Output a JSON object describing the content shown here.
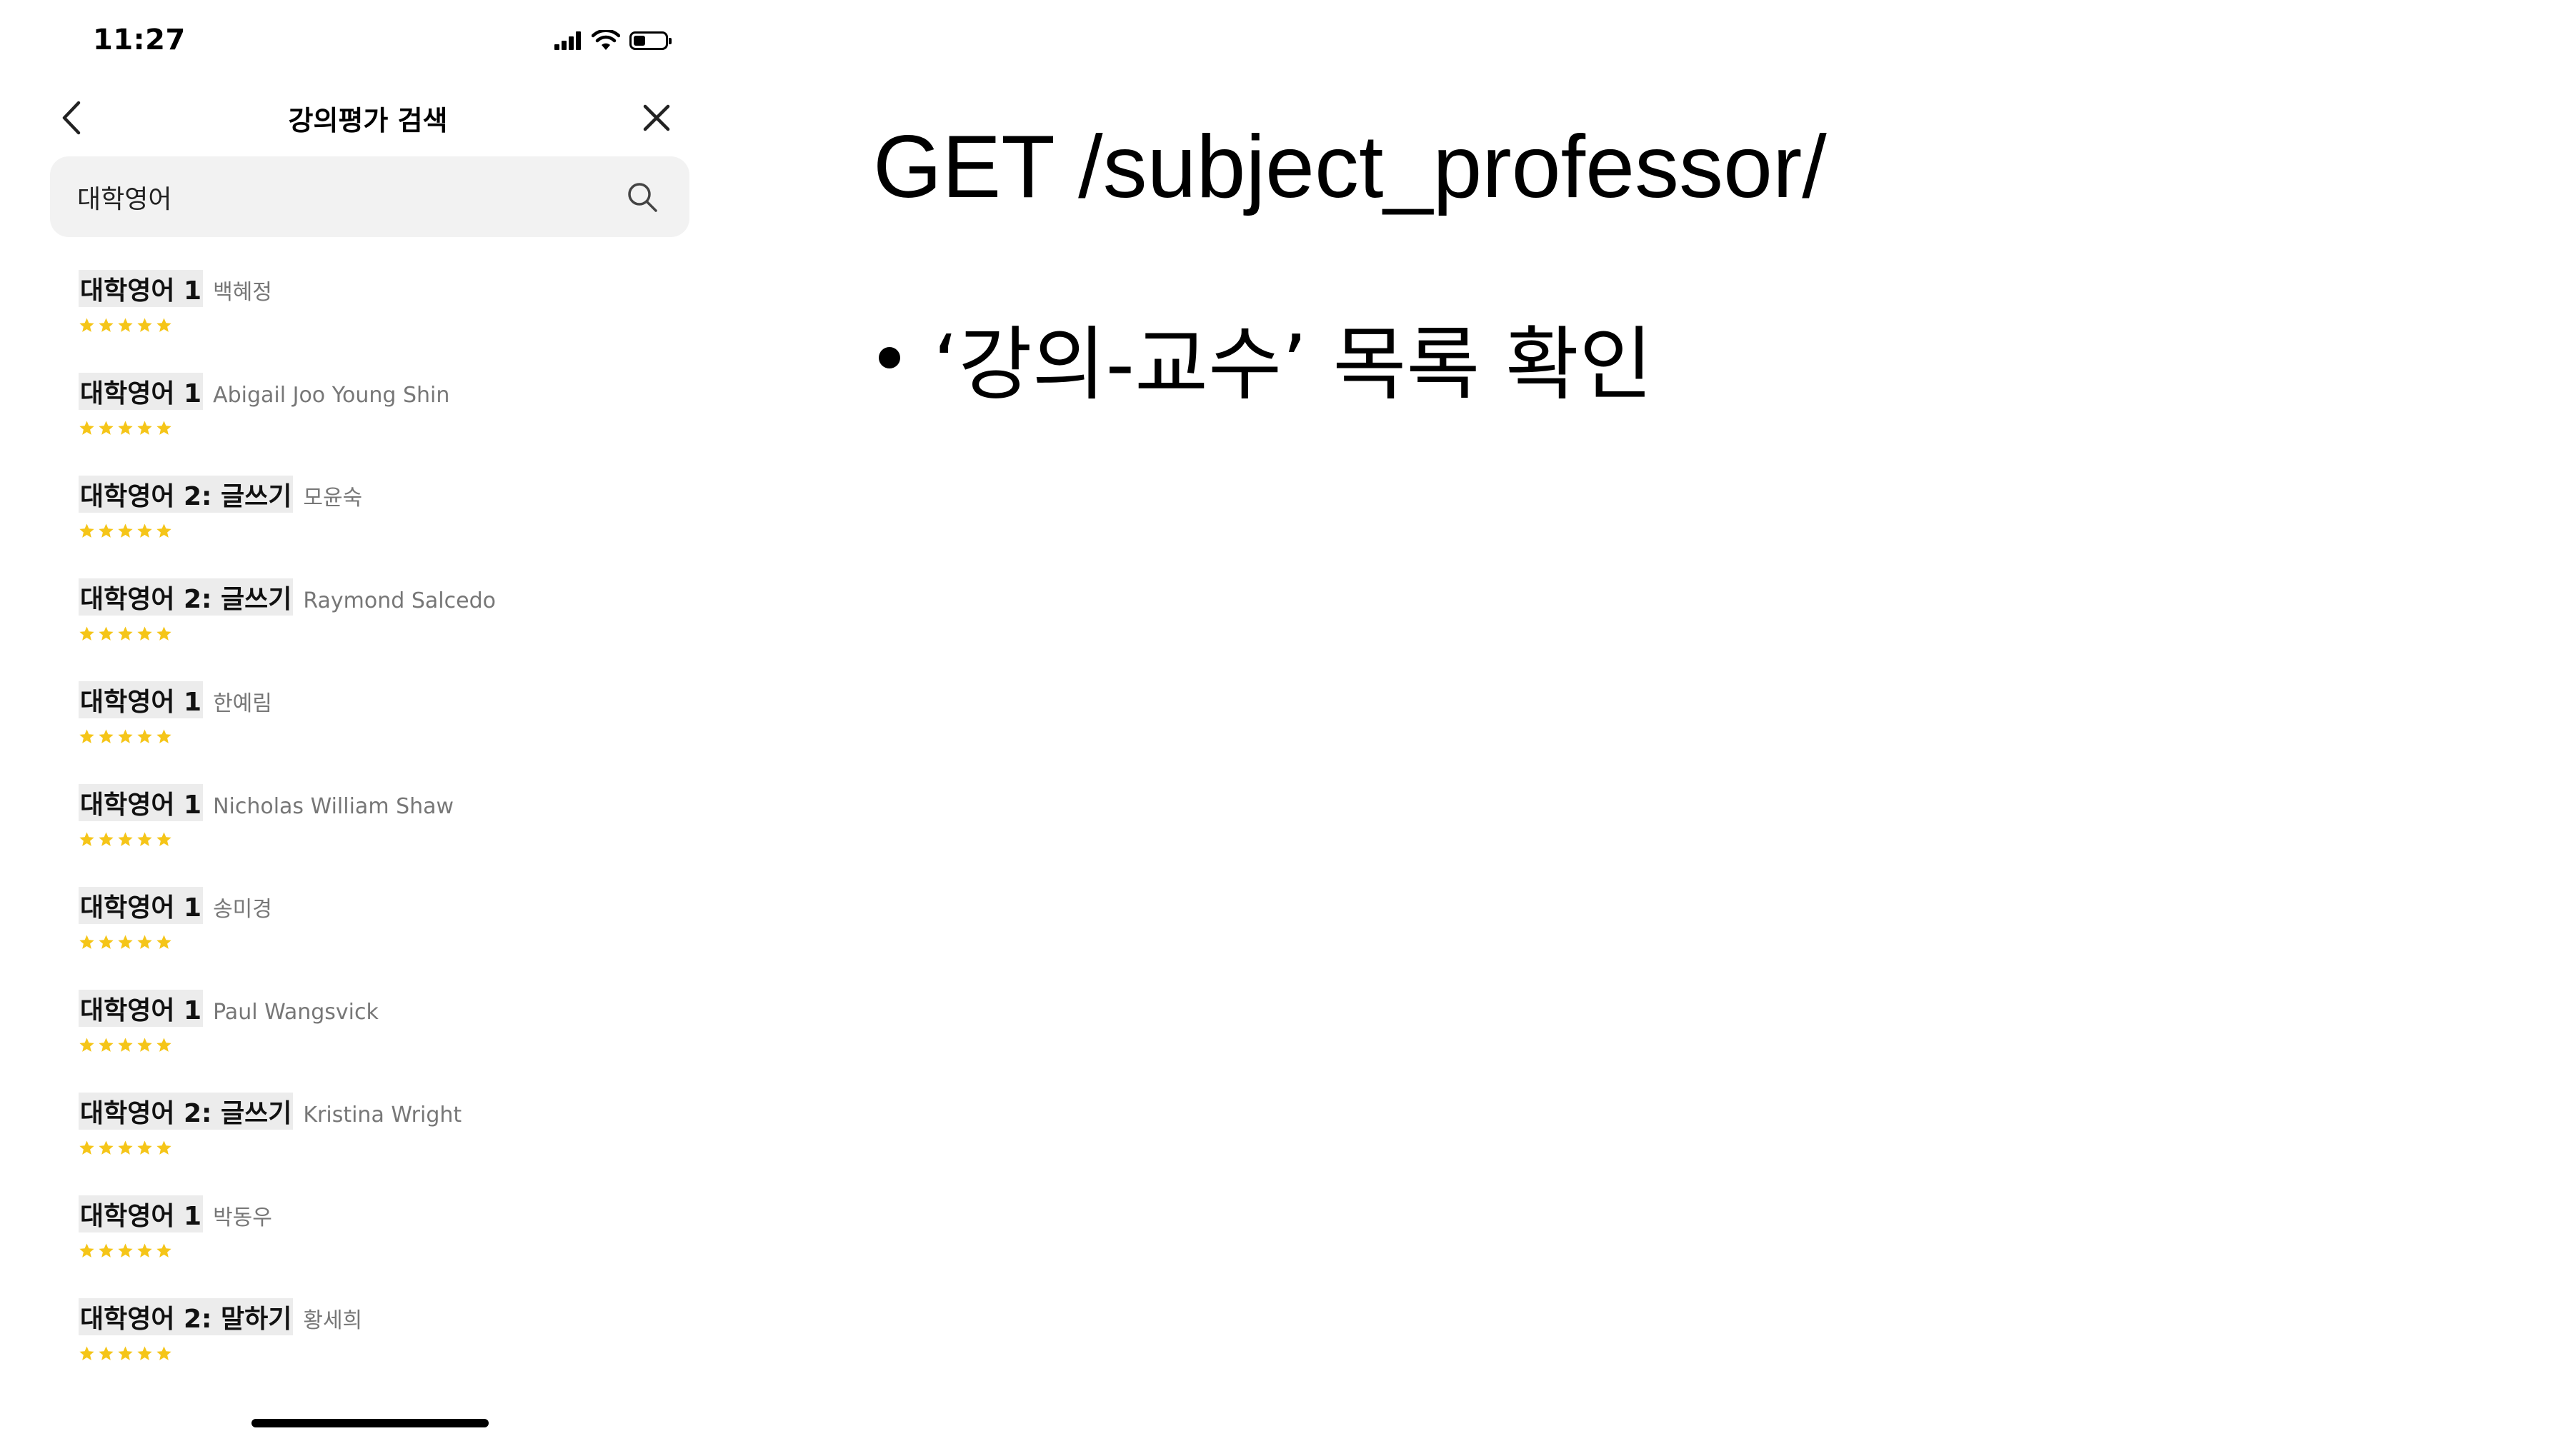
{
  "status_bar": {
    "time": "11:27"
  },
  "header": {
    "title": "강의평가 검색"
  },
  "search": {
    "value": "대학영어"
  },
  "results": [
    {
      "subject": "대학영어 1",
      "professor": "백혜정"
    },
    {
      "subject": "대학영어 1",
      "professor": "Abigail Joo Young Shin"
    },
    {
      "subject": "대학영어 2: 글쓰기",
      "professor": "모윤숙"
    },
    {
      "subject": "대학영어 2: 글쓰기",
      "professor": "Raymond Salcedo"
    },
    {
      "subject": "대학영어 1",
      "professor": "한예림"
    },
    {
      "subject": "대학영어 1",
      "professor": "Nicholas William Shaw"
    },
    {
      "subject": "대학영어 1",
      "professor": "송미경"
    },
    {
      "subject": "대학영어 1",
      "professor": "Paul Wangsvick"
    },
    {
      "subject": "대학영어 2: 글쓰기",
      "professor": "Kristina Wright"
    },
    {
      "subject": "대학영어 1",
      "professor": "박동우"
    },
    {
      "subject": "대학영어 2: 말하기",
      "professor": "황세희"
    }
  ],
  "rating": {
    "stars_filled": 5,
    "stars_total": 5,
    "star_color": "#f5c518"
  },
  "slide": {
    "title": "GET /subject_professor/",
    "bullet": "‘강의-교수’ 목록 확인"
  }
}
